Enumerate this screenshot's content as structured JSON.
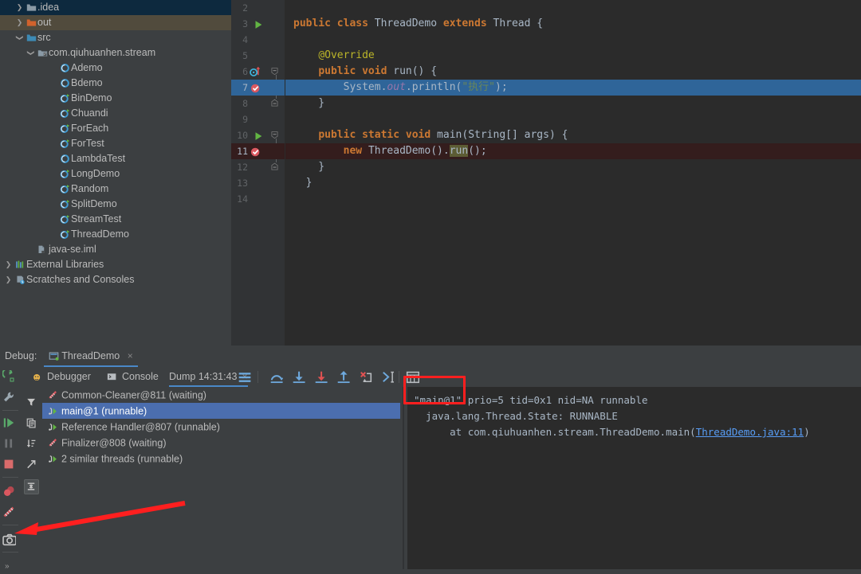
{
  "project_tree": {
    "rows": [
      {
        "label": ".idea",
        "indent": 1,
        "twisty": "chevron-right",
        "icon": "folder-gray",
        "state": "selected-inactive"
      },
      {
        "label": "out",
        "indent": 1,
        "twisty": "chevron-right",
        "icon": "folder-orange",
        "state": "selected-out"
      },
      {
        "label": "src",
        "indent": 1,
        "twisty": "chevron-down",
        "icon": "folder-blue",
        "state": "none"
      },
      {
        "label": "com.qiuhuanhen.stream",
        "indent": 2,
        "twisty": "chevron-down",
        "icon": "package",
        "state": "none"
      },
      {
        "label": "Ademo",
        "indent": 4,
        "twisty": "none",
        "icon": "class",
        "state": "none"
      },
      {
        "label": "Bdemo",
        "indent": 4,
        "twisty": "none",
        "icon": "class",
        "state": "none"
      },
      {
        "label": "BinDemo",
        "indent": 4,
        "twisty": "none",
        "icon": "class-runnable",
        "state": "none"
      },
      {
        "label": "Chuandi",
        "indent": 4,
        "twisty": "none",
        "icon": "class-runnable",
        "state": "none"
      },
      {
        "label": "ForEach",
        "indent": 4,
        "twisty": "none",
        "icon": "class-runnable",
        "state": "none"
      },
      {
        "label": "ForTest",
        "indent": 4,
        "twisty": "none",
        "icon": "class-runnable",
        "state": "none"
      },
      {
        "label": "LambdaTest",
        "indent": 4,
        "twisty": "none",
        "icon": "class",
        "state": "none"
      },
      {
        "label": "LongDemo",
        "indent": 4,
        "twisty": "none",
        "icon": "class-runnable",
        "state": "none"
      },
      {
        "label": "Random",
        "indent": 4,
        "twisty": "none",
        "icon": "class-runnable",
        "state": "none"
      },
      {
        "label": "SplitDemo",
        "indent": 4,
        "twisty": "none",
        "icon": "class-runnable",
        "state": "none"
      },
      {
        "label": "StreamTest",
        "indent": 4,
        "twisty": "none",
        "icon": "class-runnable",
        "state": "none"
      },
      {
        "label": "ThreadDemo",
        "indent": 4,
        "twisty": "none",
        "icon": "class-runnable",
        "state": "none"
      },
      {
        "label": "java-se.iml",
        "indent": 2,
        "twisty": "none",
        "icon": "iml-file",
        "state": "none"
      },
      {
        "label": "External Libraries",
        "indent": 0,
        "twisty": "chevron-right",
        "icon": "libraries",
        "state": "none"
      },
      {
        "label": "Scratches and Consoles",
        "indent": 0,
        "twisty": "chevron-right",
        "icon": "scratches",
        "state": "none"
      }
    ]
  },
  "editor": {
    "lines": [
      {
        "num": "2",
        "gutter": "none",
        "fold": "none",
        "highlight": "none",
        "text": ""
      },
      {
        "num": "3",
        "gutter": "run",
        "fold": "none",
        "highlight": "none",
        "text": "public class ThreadDemo extends Thread {"
      },
      {
        "num": "4",
        "gutter": "none",
        "fold": "none",
        "highlight": "none",
        "text": ""
      },
      {
        "num": "5",
        "gutter": "none",
        "fold": "none",
        "highlight": "none",
        "text": "    @Override"
      },
      {
        "num": "6",
        "gutter": "override",
        "fold": "open",
        "highlight": "none",
        "text": "    public void run() {"
      },
      {
        "num": "7",
        "gutter": "breakpoint",
        "fold": "none",
        "highlight": "select",
        "text": "        System.out.println(\"执行\");"
      },
      {
        "num": "8",
        "gutter": "none",
        "fold": "close",
        "highlight": "none",
        "text": "    }"
      },
      {
        "num": "9",
        "gutter": "none",
        "fold": "none",
        "highlight": "none",
        "text": ""
      },
      {
        "num": "10",
        "gutter": "run",
        "fold": "open",
        "highlight": "none",
        "text": "    public static void main(String[] args) {"
      },
      {
        "num": "11",
        "gutter": "breakpoint",
        "fold": "none",
        "highlight": "bp",
        "text": "        new ThreadDemo().run();"
      },
      {
        "num": "12",
        "gutter": "none",
        "fold": "close",
        "highlight": "none",
        "text": "    }"
      },
      {
        "num": "13",
        "gutter": "none",
        "fold": "none",
        "highlight": "none",
        "text": "  }"
      },
      {
        "num": "14",
        "gutter": "none",
        "fold": "none",
        "highlight": "none",
        "text": ""
      }
    ],
    "colors": {
      "background": "#2b2b2b",
      "gutter_background": "#313335",
      "keyword": "#cc7832",
      "string": "#6a8759",
      "annotation": "#bbb529",
      "field": "#9876aa",
      "default_text": "#a9b7c6",
      "line_number": "#606366",
      "selection": "#2f6599",
      "breakpoint_line": "#341d1d"
    }
  },
  "debug": {
    "label": "Debug:",
    "tab_title": "ThreadDemo",
    "tab_close": "×",
    "sub_tabs": [
      {
        "id": "debugger",
        "label": "Debugger",
        "icon": "debugger-icon",
        "active": false
      },
      {
        "id": "console",
        "label": "Console",
        "icon": "console-icon",
        "active": false
      },
      {
        "id": "dump",
        "label": "Dump 14:31:43",
        "icon": "none",
        "active": true,
        "closable": true
      }
    ],
    "toolbar_icons": [
      "layout-settings-icon",
      "step-over-icon",
      "step-into-icon",
      "force-step-into-icon",
      "step-out-icon",
      "drop-frame-icon",
      "run-to-cursor-icon",
      "evaluate-expression-icon"
    ],
    "left_toolbar_icons": [
      "rerun-icon",
      "edit-configurations-icon",
      "resume-program-icon",
      "pause-program-icon",
      "stop-icon",
      "view-breakpoints-icon",
      "mute-breakpoints-icon",
      "get-thread-dump-icon"
    ],
    "left_toolbar_overflow": "»",
    "column2_icons": [
      "filter-threads-icon",
      "copy-to-clipboard-icon",
      "sort-threads-icon",
      "export-icon",
      "collapse-merge-icon"
    ],
    "threads": [
      {
        "label": "Common-Cleaner@811 (waiting)",
        "icon": "thread-waiting-icon",
        "selected": false
      },
      {
        "label": "main@1 (runnable)",
        "icon": "thread-runnable-icon",
        "selected": true
      },
      {
        "label": "Reference Handler@807 (runnable)",
        "icon": "thread-runnable-icon",
        "selected": false
      },
      {
        "label": "Finalizer@808 (waiting)",
        "icon": "thread-waiting-icon",
        "selected": false
      },
      {
        "label": "2 similar threads (runnable)",
        "icon": "thread-runnable-icon",
        "selected": false
      }
    ],
    "dump_detail": {
      "line1_name": "\"main@1\"",
      "line1_rest": " prio=5 tid=0x1 nid=NA runnable",
      "line2": "  java.lang.Thread.State: RUNNABLE",
      "line3_prefix": "      at com.qiuhuanhen.stream.ThreadDemo.main(",
      "line3_link": "ThreadDemo.java:11",
      "line3_suffix": ")"
    }
  },
  "annotations": {
    "highlight_rect_target": "main@1 thread name in dump output",
    "arrow_target": "get-thread-dump-icon",
    "color": "#ff1f1f"
  }
}
